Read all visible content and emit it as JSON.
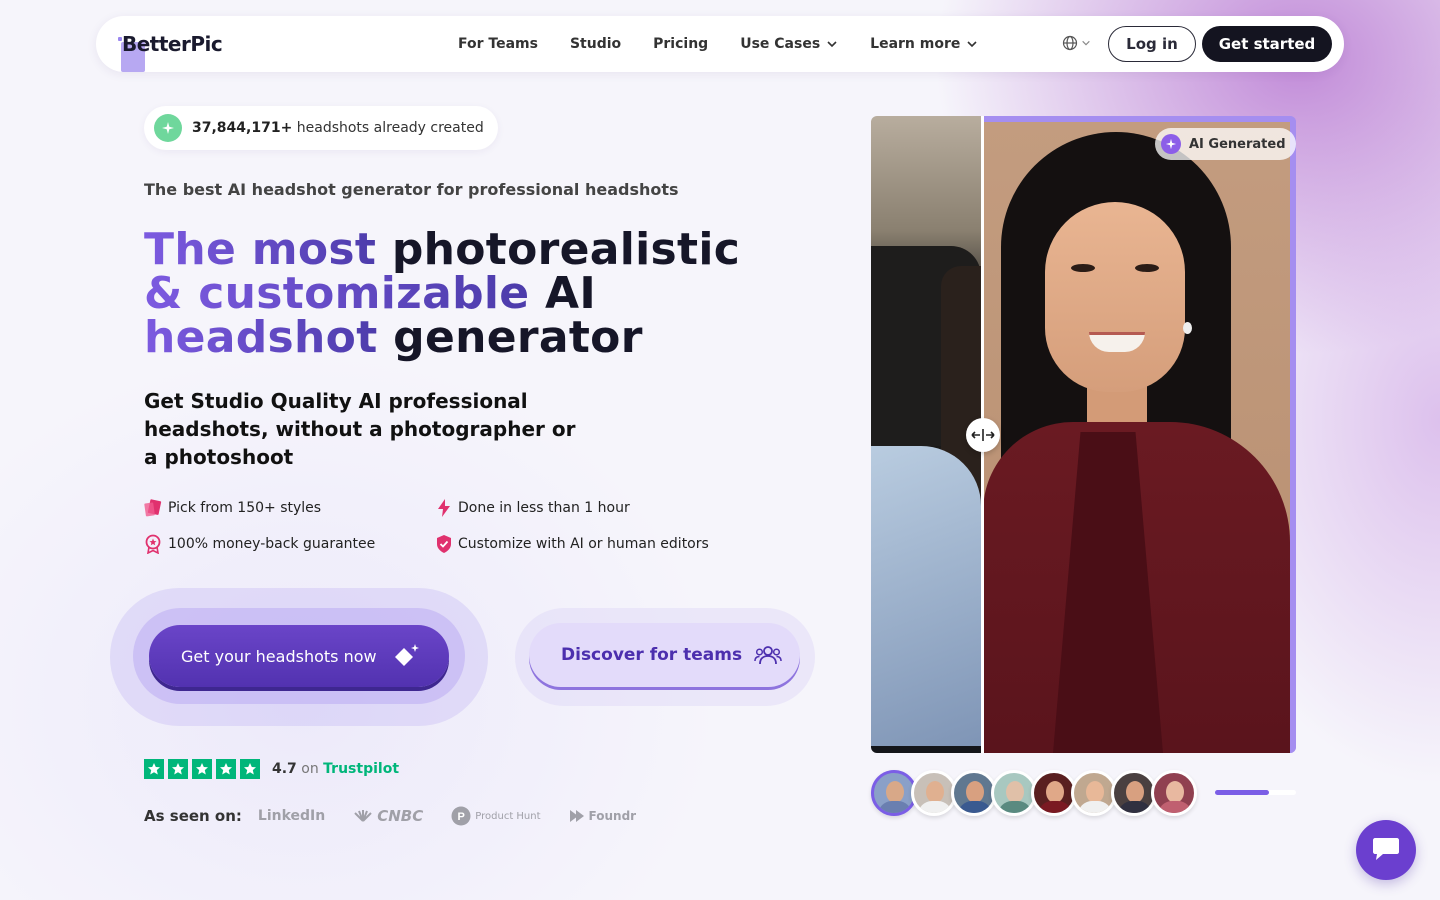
{
  "nav": {
    "logo": "BetterPic",
    "links": [
      {
        "label": "For Teams",
        "dropdown": false
      },
      {
        "label": "Studio",
        "dropdown": false
      },
      {
        "label": "Pricing",
        "dropdown": false
      },
      {
        "label": "Use Cases",
        "dropdown": true
      },
      {
        "label": "Learn more",
        "dropdown": true
      }
    ],
    "login": "Log in",
    "get_started": "Get started"
  },
  "counter": {
    "number": "37,844,171+",
    "text": " headshots already created"
  },
  "subhead": "The best AI headshot generator for professional headshots",
  "headline": {
    "l1a": "The most ",
    "l1b": "photorealistic",
    "l2a": "& customizable ",
    "l2b": "AI",
    "l3a": "headshot ",
    "l3b": "generator"
  },
  "lead": "Get Studio Quality AI professional headshots, without a photographer or a photoshoot",
  "features": [
    {
      "icon": "styles-icon",
      "label": "Pick from 150+ styles"
    },
    {
      "icon": "lightning-icon",
      "label": "Done in less than 1 hour"
    },
    {
      "icon": "guarantee-badge-icon",
      "label": "100% money-back guarantee"
    },
    {
      "icon": "shield-check-icon",
      "label": "Customize with AI or human editors"
    }
  ],
  "cta": {
    "primary": "Get your headshots now",
    "secondary": "Discover for teams"
  },
  "trust": {
    "rating": "4.7",
    "on": "on",
    "provider": "Trustpilot",
    "stars": 5
  },
  "seen_on": {
    "label": "As seen on:",
    "outlets": [
      "LinkedIn",
      "CNBC",
      "Product Hunt",
      "Foundr"
    ]
  },
  "compare": {
    "badge": "AI Generated"
  },
  "carousel": {
    "progress": 0.67,
    "thumbs": 8
  },
  "colors": {
    "accent": "#6a45c8",
    "trustpilot": "#00b67a",
    "dark": "#141420"
  }
}
